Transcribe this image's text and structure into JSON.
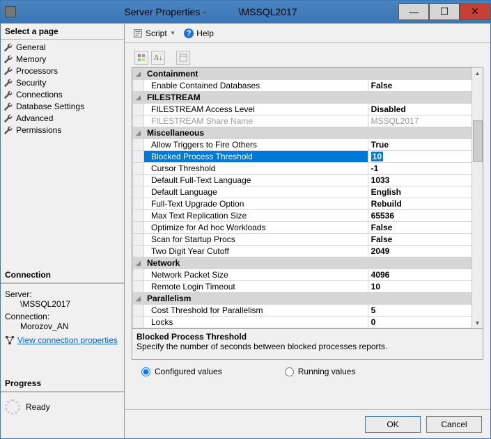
{
  "window": {
    "title": "Server Properties -            \\MSSQL2017",
    "min": "—",
    "max": "☐",
    "close": "✕"
  },
  "left": {
    "select_page": "Select a page",
    "nav": [
      "General",
      "Memory",
      "Processors",
      "Security",
      "Connections",
      "Database Settings",
      "Advanced",
      "Permissions"
    ],
    "connection_hdr": "Connection",
    "server_lbl": "Server:",
    "server_val": "\\MSSQL2017",
    "conn_lbl": "Connection:",
    "conn_val": "Morozov_AN",
    "view_props": "View connection properties",
    "progress_hdr": "Progress",
    "ready": "Ready"
  },
  "toolbar": {
    "script": "Script",
    "dd": "▾",
    "help": "Help"
  },
  "grid": {
    "cats": [
      {
        "name": "Containment",
        "rows": [
          {
            "n": "Enable Contained Databases",
            "v": "False"
          }
        ]
      },
      {
        "name": "FILESTREAM",
        "rows": [
          {
            "n": "FILESTREAM Access Level",
            "v": "Disabled"
          },
          {
            "n": "FILESTREAM Share Name",
            "v": "MSSQL2017",
            "dis": true
          }
        ]
      },
      {
        "name": "Miscellaneous",
        "rows": [
          {
            "n": "Allow Triggers to Fire Others",
            "v": "True"
          },
          {
            "n": "Blocked Process Threshold",
            "v": "10",
            "sel": true
          },
          {
            "n": "Cursor Threshold",
            "v": "-1"
          },
          {
            "n": "Default Full-Text Language",
            "v": "1033"
          },
          {
            "n": "Default Language",
            "v": "English"
          },
          {
            "n": "Full-Text Upgrade Option",
            "v": "Rebuild"
          },
          {
            "n": "Max Text Replication Size",
            "v": "65536"
          },
          {
            "n": "Optimize for Ad hoc Workloads",
            "v": "False"
          },
          {
            "n": "Scan for Startup Procs",
            "v": "False"
          },
          {
            "n": "Two Digit Year Cutoff",
            "v": "2049"
          }
        ]
      },
      {
        "name": "Network",
        "rows": [
          {
            "n": "Network Packet Size",
            "v": "4096"
          },
          {
            "n": "Remote Login Timeout",
            "v": "10"
          }
        ]
      },
      {
        "name": "Parallelism",
        "rows": [
          {
            "n": "Cost Threshold for Parallelism",
            "v": "5"
          },
          {
            "n": "Locks",
            "v": "0"
          }
        ]
      }
    ]
  },
  "desc": {
    "title": "Blocked Process Threshold",
    "text": "Specify the number of seconds between blocked processes reports."
  },
  "radios": {
    "configured": "Configured values",
    "running": "Running values"
  },
  "footer": {
    "ok": "OK",
    "cancel": "Cancel"
  }
}
